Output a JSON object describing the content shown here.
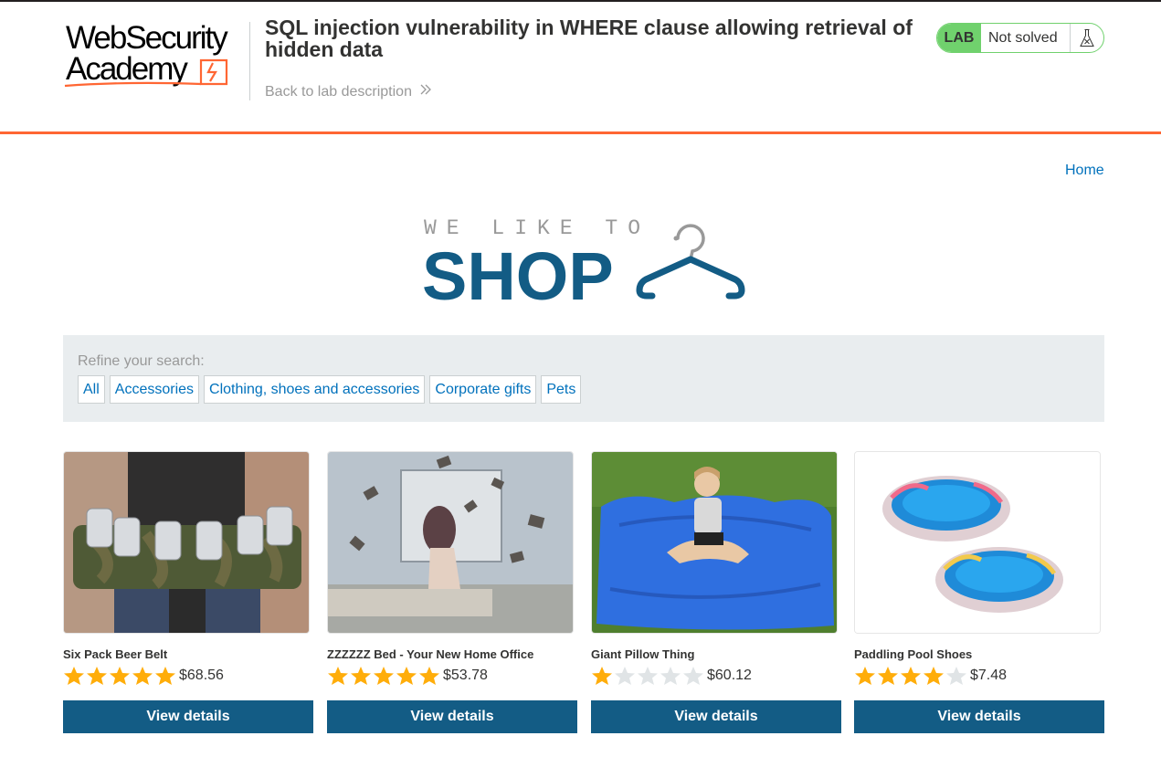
{
  "header": {
    "logo_line1": "WebSecurity",
    "logo_line2": "Academy",
    "lab_title": "SQL injection vulnerability in WHERE clause allowing retrieval of hidden data",
    "back_link": "Back to lab description",
    "lab_badge": "LAB",
    "lab_status": "Not solved"
  },
  "nav": {
    "home": "Home"
  },
  "banner": {
    "small_text": "WE LIKE TO",
    "big_text": "SHOP"
  },
  "filters": {
    "label": "Refine your search:",
    "items": [
      "All",
      "Accessories",
      "Clothing, shoes and accessories",
      "Corporate gifts",
      "Pets"
    ]
  },
  "products": [
    {
      "name": "Six Pack Beer Belt",
      "rating": 5,
      "price": "$68.56",
      "button": "View details"
    },
    {
      "name": "ZZZZZZ Bed - Your New Home Office",
      "rating": 5,
      "price": "$53.78",
      "button": "View details"
    },
    {
      "name": "Giant Pillow Thing",
      "rating": 1,
      "price": "$60.12",
      "button": "View details"
    },
    {
      "name": "Paddling Pool Shoes",
      "rating": 4,
      "price": "$7.48",
      "button": "View details"
    }
  ],
  "colors": {
    "accent_orange": "#ff6633",
    "brand_blue": "#135c85",
    "link_blue": "#0071bc",
    "lab_green": "#70d16d",
    "star_gold": "#ffad0a",
    "star_grey": "#e0e4e6"
  },
  "icons": {
    "back": "double-chevron-right-icon",
    "flask": "flask-icon",
    "hanger": "hanger-icon",
    "star": "star-icon"
  }
}
